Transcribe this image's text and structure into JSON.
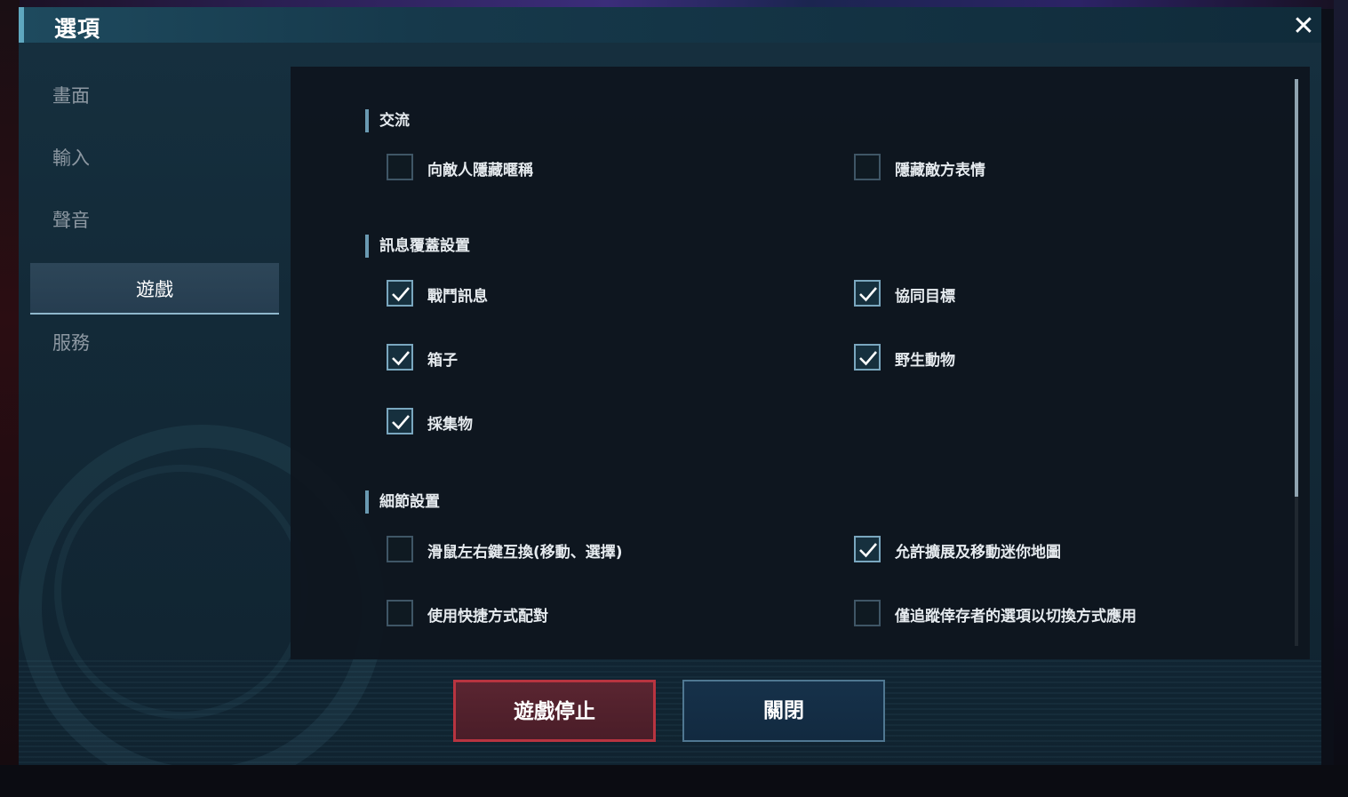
{
  "window": {
    "title": "選項",
    "close_icon": "close-icon"
  },
  "sidebar": {
    "items": [
      {
        "label": "畫面",
        "active": false
      },
      {
        "label": "輸入",
        "active": false
      },
      {
        "label": "聲音",
        "active": false
      },
      {
        "label": "遊戲",
        "active": true
      },
      {
        "label": "服務",
        "active": false
      }
    ]
  },
  "sections": [
    {
      "title": "交流",
      "options": [
        {
          "label": "向敵人隱藏暱稱",
          "checked": false
        },
        {
          "label": "隱藏敵方表情",
          "checked": false
        }
      ]
    },
    {
      "title": "訊息覆蓋設置",
      "options": [
        {
          "label": "戰鬥訊息",
          "checked": true
        },
        {
          "label": "協同目標",
          "checked": true
        },
        {
          "label": "箱子",
          "checked": true
        },
        {
          "label": "野生動物",
          "checked": true
        },
        {
          "label": "採集物",
          "checked": true
        }
      ]
    },
    {
      "title": "細節設置",
      "options": [
        {
          "label": "滑鼠左右鍵互換(移動、選擇)",
          "checked": false
        },
        {
          "label": "允許擴展及移動迷你地圖",
          "checked": true
        },
        {
          "label": "使用快捷方式配對",
          "checked": false
        },
        {
          "label": "僅追蹤倖存者的選項以切換方式應用",
          "checked": false
        }
      ]
    }
  ],
  "footer": {
    "stop_label": "遊戲停止",
    "close_label": "關閉"
  },
  "colors": {
    "accent": "#6a9ab2",
    "stop_border": "#b83440",
    "close_border": "#4f7791"
  }
}
